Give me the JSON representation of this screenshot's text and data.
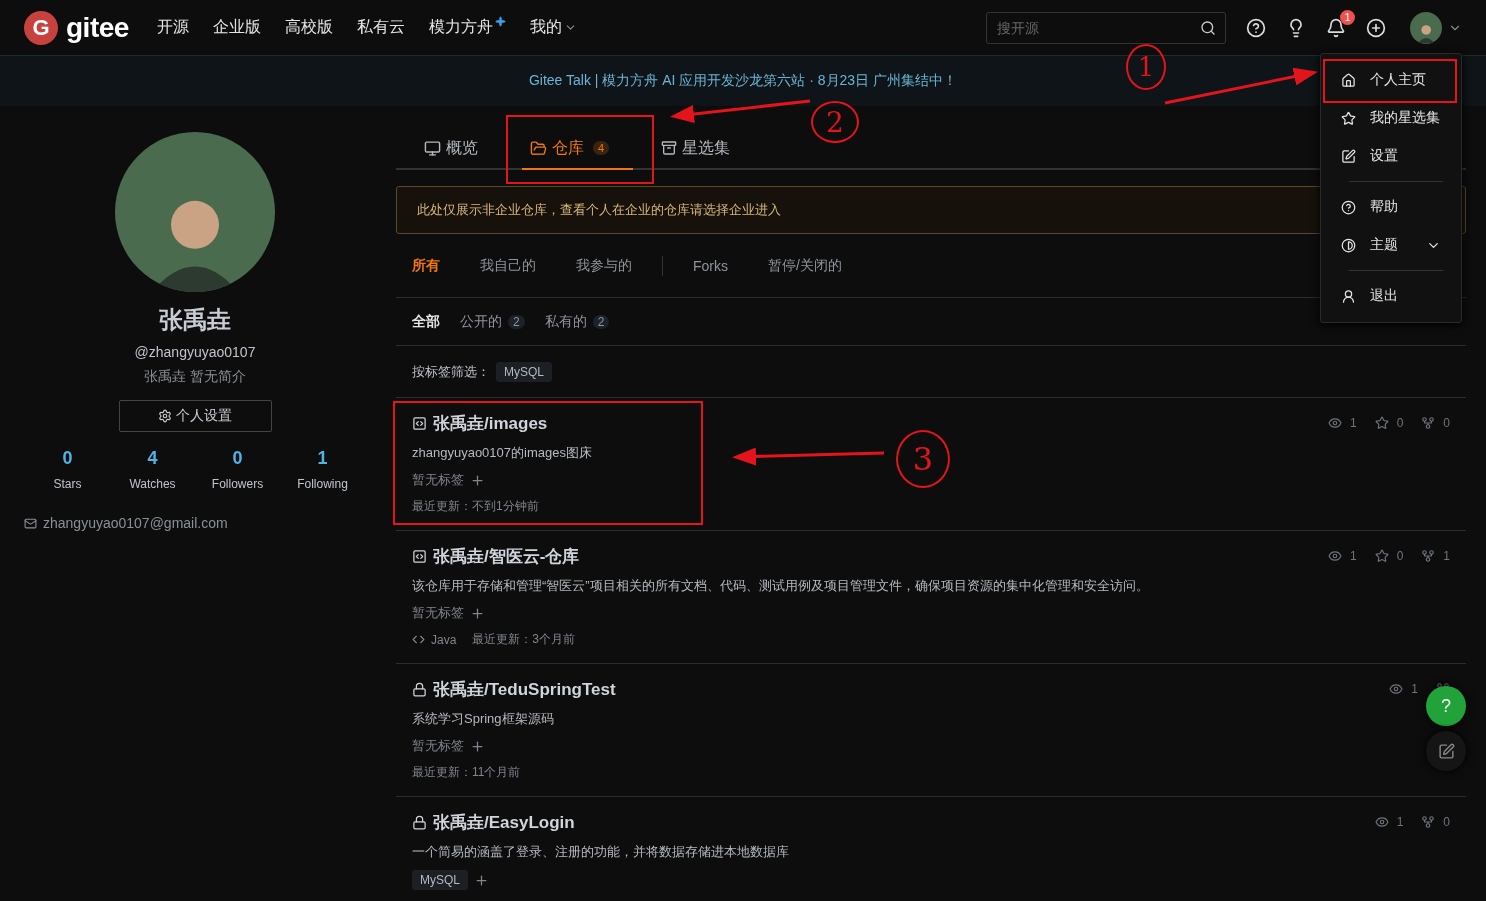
{
  "header": {
    "logo_mark": "G",
    "brand": "gitee",
    "nav": [
      {
        "label": "开源",
        "kind": "plain"
      },
      {
        "label": "企业版",
        "kind": "plain"
      },
      {
        "label": "高校版",
        "kind": "plain"
      },
      {
        "label": "私有云",
        "kind": "plain"
      },
      {
        "label": "模力方舟",
        "kind": "sparkle"
      },
      {
        "label": "我的",
        "kind": "caret"
      }
    ],
    "search": {
      "placeholder": "搜开源"
    },
    "notification_badge": "1"
  },
  "banner": "Gitee Talk | 模力方舟 AI 应用开发沙龙第六站 · 8月23日 广州集结中！",
  "profile": {
    "name": "张禹垚",
    "username": "@zhangyuyao0107",
    "bio": "张禹垚 暂无简介",
    "settings_button": "个人设置",
    "stats": [
      {
        "value": "0",
        "label": "Stars"
      },
      {
        "value": "4",
        "label": "Watches"
      },
      {
        "value": "0",
        "label": "Followers"
      },
      {
        "value": "1",
        "label": "Following"
      }
    ],
    "email": "zhangyuyao0107@gmail.com"
  },
  "tabs": [
    {
      "label": "概览",
      "kind": "overview",
      "selected": false
    },
    {
      "label": "仓库",
      "kind": "repo",
      "badge": "4",
      "selected": true
    },
    {
      "label": "星选集",
      "kind": "collection",
      "selected": false
    }
  ],
  "notice": "此处仅展示非企业仓库，查看个人在企业的仓库请选择企业进入",
  "filters": [
    {
      "label": "所有",
      "selected": true
    },
    {
      "label": "我自己的",
      "selected": false
    },
    {
      "label": "我参与的",
      "selected": false
    },
    {
      "label": "Forks",
      "selected": false
    },
    {
      "label": "暂停/关闭的",
      "selected": false
    }
  ],
  "visibility": [
    {
      "label": "全部",
      "selected": true
    },
    {
      "label": "公开的",
      "count": "2",
      "selected": false
    },
    {
      "label": "私有的",
      "count": "2",
      "selected": false
    }
  ],
  "tag_filter": {
    "label": "按标签筛选：",
    "tags": [
      "MySQL"
    ]
  },
  "repos": [
    {
      "kind": "public",
      "title": "张禹垚/images",
      "description": "zhangyuyao0107的images图床",
      "no_tags": "暂无标签",
      "updated": "最近更新：不到1分钟前",
      "stats": [
        {
          "kind": "watch",
          "value": "1"
        },
        {
          "kind": "star",
          "value": "0"
        },
        {
          "kind": "fork",
          "value": "0"
        }
      ]
    },
    {
      "kind": "public",
      "title": "张禹垚/智医云-仓库",
      "description": "该仓库用于存储和管理“智医云”项目相关的所有文档、代码、测试用例及项目管理文件，确保项目资源的集中化管理和安全访问。",
      "no_tags": "暂无标签",
      "language": "Java",
      "updated": "最近更新：3个月前",
      "stats": [
        {
          "kind": "watch",
          "value": "1"
        },
        {
          "kind": "star",
          "value": "0"
        },
        {
          "kind": "fork",
          "value": "1"
        }
      ]
    },
    {
      "kind": "private",
      "title": "张禹垚/TeduSpringTest",
      "description": "系统学习Spring框架源码",
      "no_tags": "暂无标签",
      "updated": "最近更新：11个月前",
      "stats": [
        {
          "kind": "watch",
          "value": "1"
        },
        {
          "kind": "fork"
        }
      ]
    },
    {
      "kind": "private",
      "title": "张禹垚/EasyLogin",
      "description": "一个简易的涵盖了登录、注册的功能，并将数据存储进本地数据库",
      "tags": [
        "MySQL"
      ],
      "stats": [
        {
          "kind": "watch",
          "value": "1"
        },
        {
          "kind": "fork",
          "value": "0"
        }
      ]
    }
  ],
  "menu": [
    {
      "kind": "home",
      "label": "个人主页"
    },
    {
      "kind": "star",
      "label": "我的星选集"
    },
    {
      "kind": "edit",
      "label": "设置"
    },
    {
      "kind": "divider"
    },
    {
      "kind": "help",
      "label": "帮助"
    },
    {
      "kind": "theme",
      "label": "主题"
    },
    {
      "kind": "divider"
    },
    {
      "kind": "logout",
      "label": "退出"
    }
  ],
  "floating": {
    "help": "?"
  },
  "annotations": [
    {
      "kind": "number",
      "text": "1"
    },
    {
      "kind": "number",
      "text": "2"
    },
    {
      "kind": "number",
      "text": "3"
    }
  ]
}
